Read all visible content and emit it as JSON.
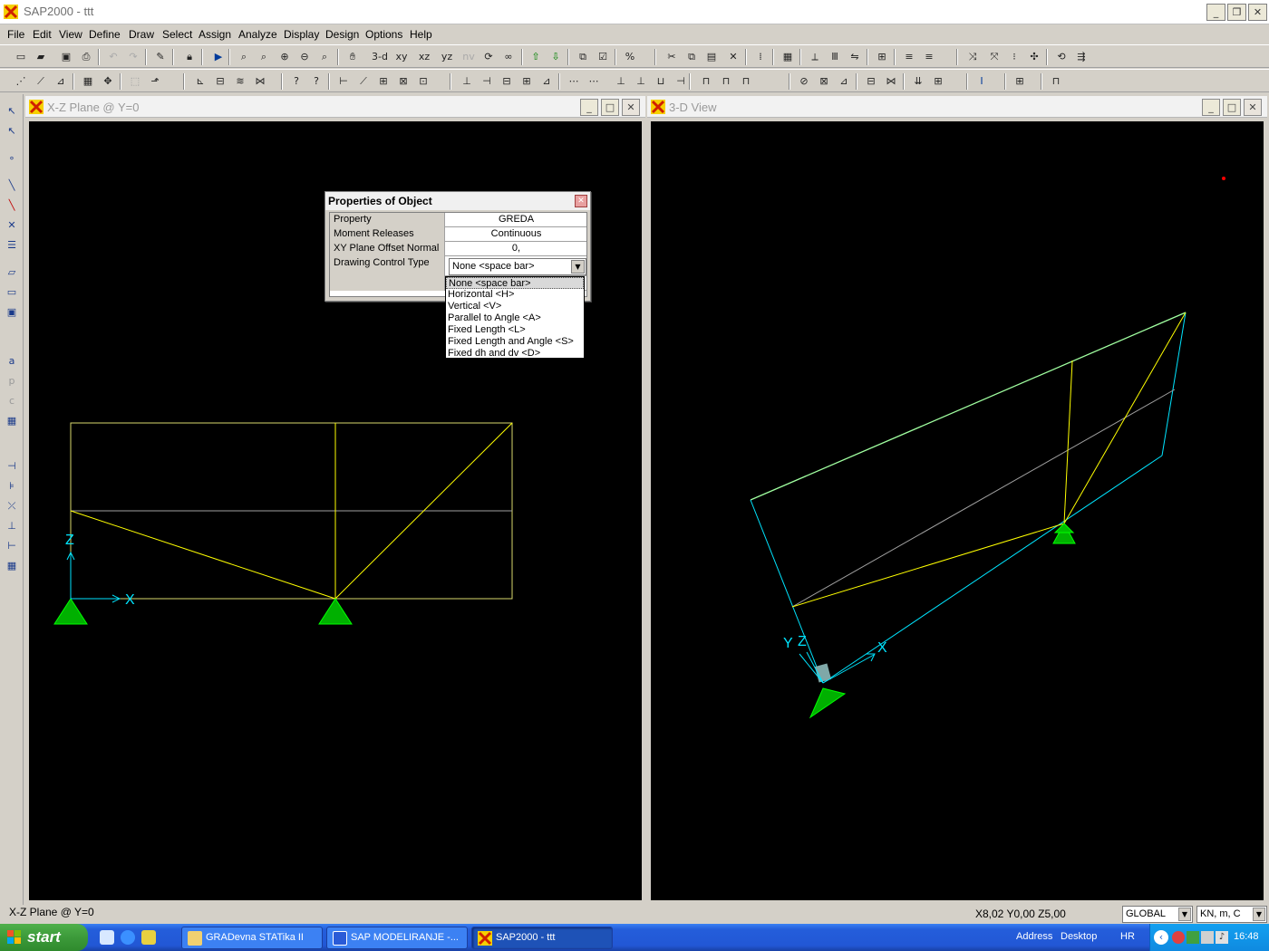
{
  "app": {
    "title": "SAP2000 - ttt",
    "window_controls": {
      "minimize": "_",
      "restore": "❐",
      "close": "✕"
    }
  },
  "menu": [
    "File",
    "Edit",
    "View",
    "Define",
    "Draw",
    "Select",
    "Assign",
    "Analyze",
    "Display",
    "Design",
    "Options",
    "Help"
  ],
  "toolbar1": {
    "view_labels": [
      "3-d",
      "xy",
      "xz",
      "yz",
      "nv"
    ]
  },
  "windows": {
    "left": {
      "title": "X-Z Plane @ Y=0"
    },
    "right": {
      "title": "3-D View"
    }
  },
  "axes": {
    "x": "X",
    "y": "Y",
    "z": "Z"
  },
  "properties_dialog": {
    "title": "Properties of Object",
    "rows": [
      {
        "name": "Property",
        "value": "GREDA"
      },
      {
        "name": "Moment Releases",
        "value": "Continuous"
      },
      {
        "name": "XY Plane Offset Normal",
        "value": "0,"
      },
      {
        "name": "Drawing Control Type",
        "value": "None  <space bar>"
      }
    ],
    "options": [
      "None  <space bar>",
      "Horizontal  <H>",
      "Vertical  <V>",
      "Parallel to Angle  <A>",
      "Fixed Length  <L>",
      "Fixed Length and Angle  <S>",
      "Fixed dh and dv  <D>"
    ],
    "selected_index": 0
  },
  "statusbar": {
    "left": "X-Z Plane @ Y=0",
    "coords": "X8,02  Y0,00  Z5,00",
    "coord_system": "GLOBAL",
    "units": "KN, m, C"
  },
  "taskbar": {
    "start": "start",
    "tasks": [
      {
        "label": "GRADevna  STATika  II",
        "icon": "folder-icon"
      },
      {
        "label": "SAP  MODELIRANJE -...",
        "icon": "word-icon"
      },
      {
        "label": "SAP2000 - ttt",
        "icon": "sap2000-icon",
        "active": true
      }
    ],
    "address": "Address",
    "desktop": "Desktop",
    "lang": "HR",
    "time": "16:48"
  },
  "colors": {
    "frame_yellow": "#ffff00",
    "frame_cyan": "#00ffff",
    "support_green": "#00c000",
    "axis_cyan": "#00e5ff"
  }
}
